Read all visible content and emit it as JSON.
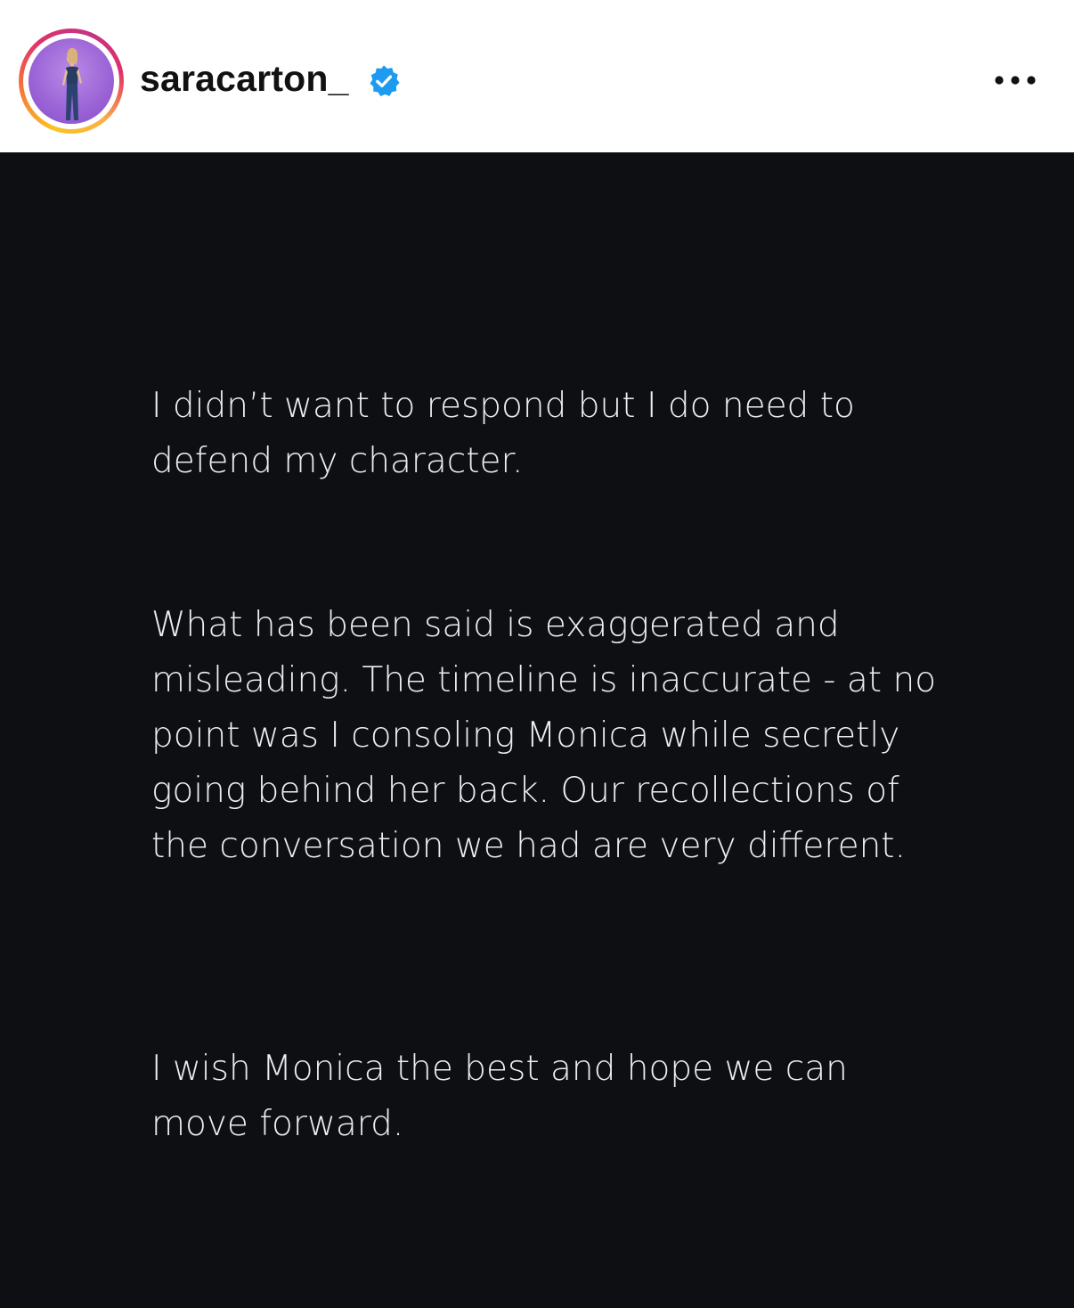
{
  "header": {
    "username": "saracarton_",
    "verified_badge_icon": "verified-check-icon",
    "more_icon": "more-horizontal-icon",
    "avatar_icon": "profile-photo-icon",
    "ring_colors": [
      "#f9c423",
      "#f77737",
      "#e1306c",
      "#c13584"
    ],
    "badge_color": "#1d9bf0"
  },
  "post": {
    "background_color": "#0d0f13",
    "text_color": "#eceef0",
    "paragraphs": [
      "I didn’t want to respond but I do need to defend my character.",
      "What has been said is exaggerated and misleading. The timeline is inaccurate - at no point was I consoling Monica while secretly going behind her back. Our recollections of the conversation we had are very different.",
      "I wish Monica the best and hope we can move forward."
    ]
  }
}
